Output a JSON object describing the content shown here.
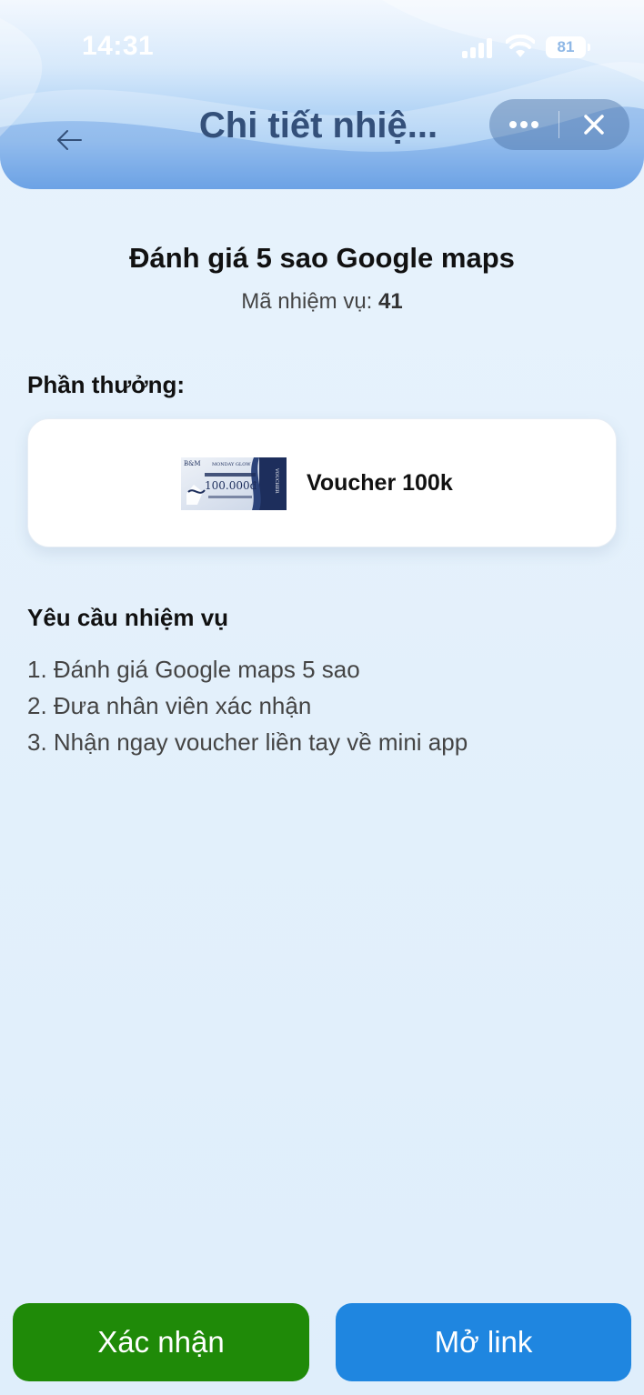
{
  "status_bar": {
    "time": "14:31",
    "battery": "81"
  },
  "header": {
    "title": "Chi tiết nhiệ..."
  },
  "task": {
    "title": "Đánh giá 5 sao Google maps",
    "code_label": "Mã nhiệm vụ:",
    "code_value": "41"
  },
  "reward": {
    "label": "Phần thưởng:",
    "voucher_name": "Voucher 100k",
    "voucher_image": {
      "brand": "B&M",
      "line1": "MONDAY GLOW",
      "amount": "100.000đ",
      "side_text": "VOUCHER"
    }
  },
  "requirements": {
    "title": "Yêu cầu nhiệm vụ",
    "items": [
      "1. Đánh giá Google maps 5 sao",
      "2. Đưa nhân viên xác nhận",
      "3. Nhận ngay voucher liền tay về mini app"
    ]
  },
  "buttons": {
    "confirm": "Xác nhận",
    "open_link": "Mở link"
  },
  "colors": {
    "confirm_button": "#1f8a08",
    "link_button": "#1f86e0",
    "title_color": "#34507a"
  }
}
